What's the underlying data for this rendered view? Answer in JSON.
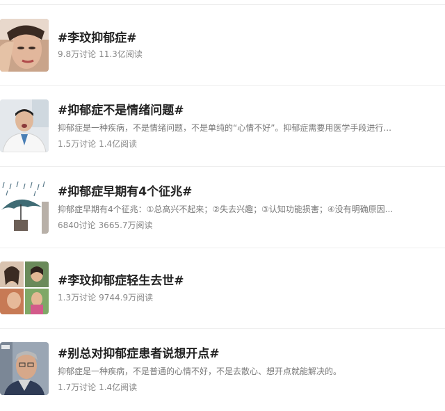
{
  "topics": [
    {
      "title": "#李玟抑郁症#",
      "desc": "",
      "discussions": "9.8万讨论",
      "reads": "11.3亿阅读",
      "thumb_icon": "portrait-photo"
    },
    {
      "title": "#抑郁症不是情绪问题#",
      "desc": "抑郁症是一种疾病，不是情绪问题，不是单纯的“心情不好”。抑郁症需要用医学手段进行...",
      "discussions": "1.5万讨论",
      "reads": "1.4亿阅读",
      "thumb_icon": "doctor-photo"
    },
    {
      "title": "#抑郁症早期有4个征兆#",
      "desc": "抑郁症早期有4个征兆：①总高兴不起来；②失去兴趣；③认知功能损害；④没有明确原因...",
      "discussions": "6840讨论",
      "reads": "3665.7万阅读",
      "thumb_icon": "umbrella-rain-illustration"
    },
    {
      "title": "#李玟抑郁症轻生去世#",
      "desc": "",
      "discussions": "1.3万讨论",
      "reads": "9744.9万阅读",
      "thumb_icon": "photo-collage"
    },
    {
      "title": "#别总对抑郁症患者说想开点#",
      "desc": "抑郁症是一种疾病，不是普通的心情不好，不是去散心、想开点就能解决的。",
      "discussions": "1.7万讨论",
      "reads": "1.4亿阅读",
      "thumb_icon": "elderly-man-photo"
    }
  ]
}
